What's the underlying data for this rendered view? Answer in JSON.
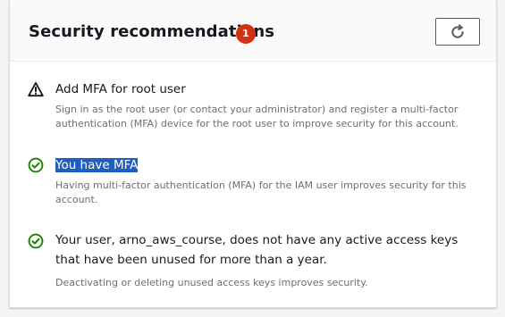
{
  "panel": {
    "title": "Security recommendations",
    "badge_count": "1",
    "refresh_icon": "refresh-icon"
  },
  "recommendations": [
    {
      "status": "warning",
      "icon": "warning-icon",
      "title": "Add MFA for root user",
      "description": "Sign in as the root user (or contact your administrator) and register a multi-factor authentication (MFA) device for the root user to improve security for this account."
    },
    {
      "status": "success",
      "icon": "check-circle-icon",
      "title": "You have MFA",
      "title_selected": true,
      "description": "Having multi-factor authentication (MFA) for the IAM user improves security for this account."
    },
    {
      "status": "success",
      "icon": "check-circle-icon",
      "title": "Your user, arno_aws_course, does not have any active access keys that have been unused for more than a year.",
      "description": "Deactivating or deleting unused access keys improves security."
    }
  ],
  "colors": {
    "warning": "#16191f",
    "success": "#1d8102",
    "badge": "#d13212",
    "selection": "#1f5fbf"
  }
}
